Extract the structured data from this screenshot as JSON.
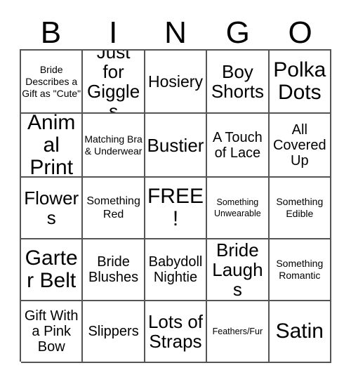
{
  "card": {
    "title_letters": [
      "B",
      "I",
      "N",
      "G",
      "O"
    ],
    "columns": 5,
    "rows": 5,
    "border_color": "#555555",
    "text_color": "#000000",
    "background_color": "#ffffff",
    "cells": [
      [
        {
          "text": "Bride Describes a Gift as \"Cute\"",
          "size": "xs"
        },
        {
          "text": "Just for Giggles",
          "size": "xl"
        },
        {
          "text": "Hosiery",
          "size": "lg"
        },
        {
          "text": "Boy Shorts",
          "size": "xl"
        },
        {
          "text": "Polka Dots",
          "size": "xxl"
        }
      ],
      [
        {
          "text": "Animal Print",
          "size": "xxl"
        },
        {
          "text": "Matching Bra & Underwear",
          "size": "xs"
        },
        {
          "text": "Bustier",
          "size": "xl"
        },
        {
          "text": "A Touch of Lace",
          "size": "md"
        },
        {
          "text": "All Covered Up",
          "size": "md"
        }
      ],
      [
        {
          "text": "Flowers",
          "size": "xl"
        },
        {
          "text": "Something Red",
          "size": "sm"
        },
        {
          "text": "FREE!",
          "size": "xxl"
        },
        {
          "text": "Something Unwearable",
          "size": "xxs"
        },
        {
          "text": "Something Edible",
          "size": "xs"
        }
      ],
      [
        {
          "text": "Garter Belt",
          "size": "xxl"
        },
        {
          "text": "Bride Blushes",
          "size": "md"
        },
        {
          "text": "Babydoll Nightie",
          "size": "md"
        },
        {
          "text": "Bride Laughs",
          "size": "xl"
        },
        {
          "text": "Something Romantic",
          "size": "xs"
        }
      ],
      [
        {
          "text": "Gift With a Pink Bow",
          "size": "md"
        },
        {
          "text": "Slippers",
          "size": "md"
        },
        {
          "text": "Lots of Straps",
          "size": "xl"
        },
        {
          "text": "Feathers/Fur",
          "size": "xxs"
        },
        {
          "text": "Satin",
          "size": "xxl"
        }
      ]
    ]
  }
}
